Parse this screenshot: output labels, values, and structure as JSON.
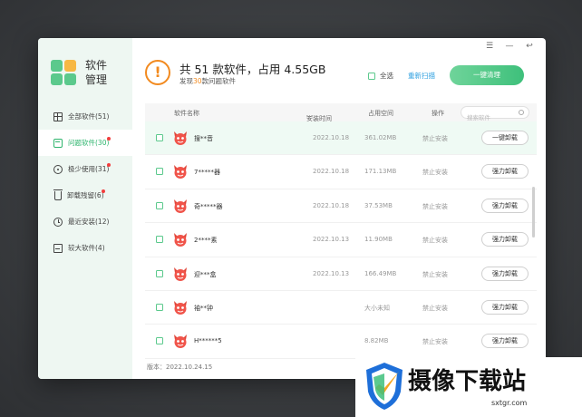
{
  "app": {
    "logo_text_line1": "软件",
    "logo_text_line2": "管理",
    "logo_colors": [
      "#5bc98c",
      "#f7b844"
    ]
  },
  "window_controls": [
    "menu-icon",
    "minimize-icon",
    "restore-icon"
  ],
  "window_controls_glyphs": [
    "☰",
    "—",
    "↩"
  ],
  "sidebar": {
    "items": [
      {
        "label": "全部软件(51)",
        "icon": "grid-icon",
        "active": false,
        "badge": false
      },
      {
        "label": "问题软件(30)",
        "icon": "box-icon",
        "active": true,
        "badge": true
      },
      {
        "label": "极少使用(31)",
        "icon": "circle-icon",
        "active": false,
        "badge": true
      },
      {
        "label": "卸载残留(6)",
        "icon": "trash-icon",
        "active": false,
        "badge": true
      },
      {
        "label": "最近安装(12)",
        "icon": "clock-icon",
        "active": false,
        "badge": false
      },
      {
        "label": "较大软件(4)",
        "icon": "disk-icon",
        "active": false,
        "badge": false
      }
    ]
  },
  "header": {
    "warn_glyph": "!",
    "title": "共 51 款软件，占用 4.55GB",
    "sub_prefix": "发现",
    "sub_count": "30",
    "sub_suffix": "款问题软件",
    "select_all": "全选",
    "rescan": "重新扫描",
    "clean_button": "一键清理"
  },
  "table": {
    "headers": {
      "name": "软件名称",
      "install_time": "安装时间",
      "size": "占用空间",
      "operation": "操作"
    },
    "search_placeholder": "搜索软件",
    "rows": [
      {
        "name": "搜**音",
        "date": "2022.10.18",
        "size": "361.02MB",
        "op": "禁止安装",
        "action": "一键卸载",
        "highlight": true
      },
      {
        "name": "7*****器",
        "date": "2022.10.18",
        "size": "171.13MB",
        "op": "禁止安装",
        "action": "强力卸载",
        "highlight": false
      },
      {
        "name": "奇*****器",
        "date": "2022.10.18",
        "size": "37.53MB",
        "op": "禁止安装",
        "action": "强力卸载",
        "highlight": false
      },
      {
        "name": "2****素",
        "date": "2022.10.13",
        "size": "11.90MB",
        "op": "禁止安装",
        "action": "强力卸载",
        "highlight": false
      },
      {
        "name": "迎***盒",
        "date": "2022.10.13",
        "size": "166.49MB",
        "op": "禁止安装",
        "action": "强力卸载",
        "highlight": false
      },
      {
        "name": "袖**钟",
        "date": "",
        "size": "大小未知",
        "op": "禁止安装",
        "action": "强力卸载",
        "highlight": false
      },
      {
        "name": "H******5",
        "date": "",
        "size": "8.82MB",
        "op": "禁止安装",
        "action": "强力卸载",
        "highlight": false
      }
    ]
  },
  "footer": {
    "version": "版本：2022.10.24.15"
  },
  "watermark": {
    "text": "摄像下载站",
    "url": "sxtgr.com"
  },
  "colors": {
    "accent_green": "#3ec07b",
    "warning_orange": "#f28a1f",
    "link_blue": "#2fa0e0",
    "badge_red": "#f23d3d"
  }
}
